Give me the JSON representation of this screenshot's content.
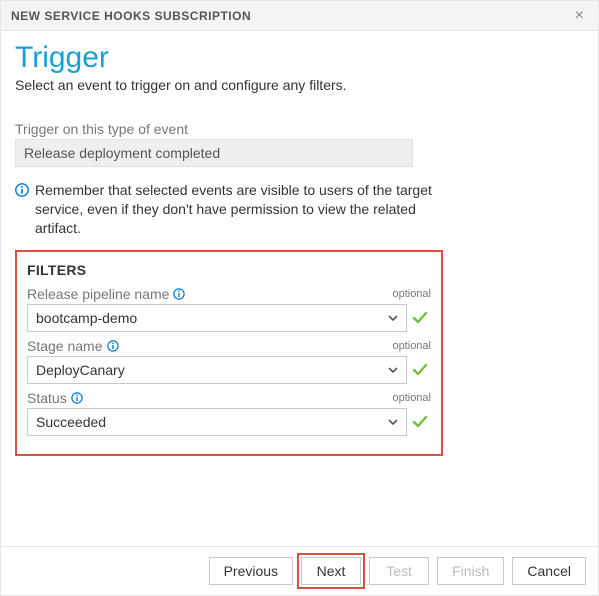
{
  "titlebar": {
    "title": "NEW SERVICE HOOKS SUBSCRIPTION"
  },
  "page": {
    "heading": "Trigger",
    "subtitle": "Select an event to trigger on and configure any filters."
  },
  "event": {
    "label": "Trigger on this type of event",
    "value": "Release deployment completed"
  },
  "info_text": "Remember that selected events are visible to users of the target service, even if they don't have permission to view the related artifact.",
  "filters": {
    "heading": "FILTERS",
    "fields": [
      {
        "label": "Release pipeline name",
        "optional": "optional",
        "value": "bootcamp-demo"
      },
      {
        "label": "Stage name",
        "optional": "optional",
        "value": "DeployCanary"
      },
      {
        "label": "Status",
        "optional": "optional",
        "value": "Succeeded"
      }
    ]
  },
  "buttons": {
    "previous": "Previous",
    "next": "Next",
    "test": "Test",
    "finish": "Finish",
    "cancel": "Cancel"
  }
}
